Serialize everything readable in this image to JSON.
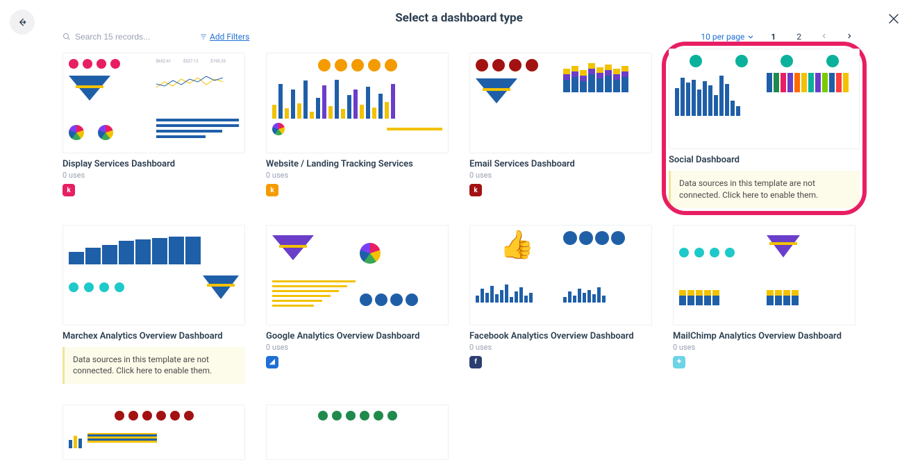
{
  "header": {
    "title": "Select a dashboard type"
  },
  "toolbar": {
    "search_placeholder": "Search 15 records...",
    "filters_label": "Add Filters",
    "per_page_label": "10 per page",
    "page_1": "1",
    "page_2": "2"
  },
  "cards": [
    {
      "title": "Display Services Dashboard",
      "uses": "0 uses",
      "badge_color": "#e81e63",
      "warning": null
    },
    {
      "title": "Website / Landing Tracking Services",
      "uses": "0 uses",
      "badge_color": "#f49b00",
      "warning": null
    },
    {
      "title": "Email Services Dashboard",
      "uses": "0 uses",
      "badge_color": "#a31212",
      "warning": null
    },
    {
      "title": "Social Dashboard",
      "uses": null,
      "badge_color": null,
      "warning": "Data sources in this template are not connected. Click here to enable them."
    },
    {
      "title": "Marchex Analytics Overview Dashboard",
      "uses": null,
      "badge_color": null,
      "warning": "Data sources in this template are not connected. Click here to enable them."
    },
    {
      "title": "Google Analytics Overview Dashboard",
      "uses": "0 uses",
      "badge_color": "#1f6fd6",
      "warning": null
    },
    {
      "title": "Facebook Analytics Overview Dashboard",
      "uses": "0 uses",
      "badge_color": "#2c3e70",
      "warning": null
    },
    {
      "title": "MailChimp Analytics Overview Dashboard",
      "uses": "0 uses",
      "badge_color": "#6cd4e6",
      "warning": null
    }
  ],
  "thumb_metrics": {
    "display_amounts": [
      "$652.61",
      "$527.12",
      "$195.25"
    ]
  }
}
